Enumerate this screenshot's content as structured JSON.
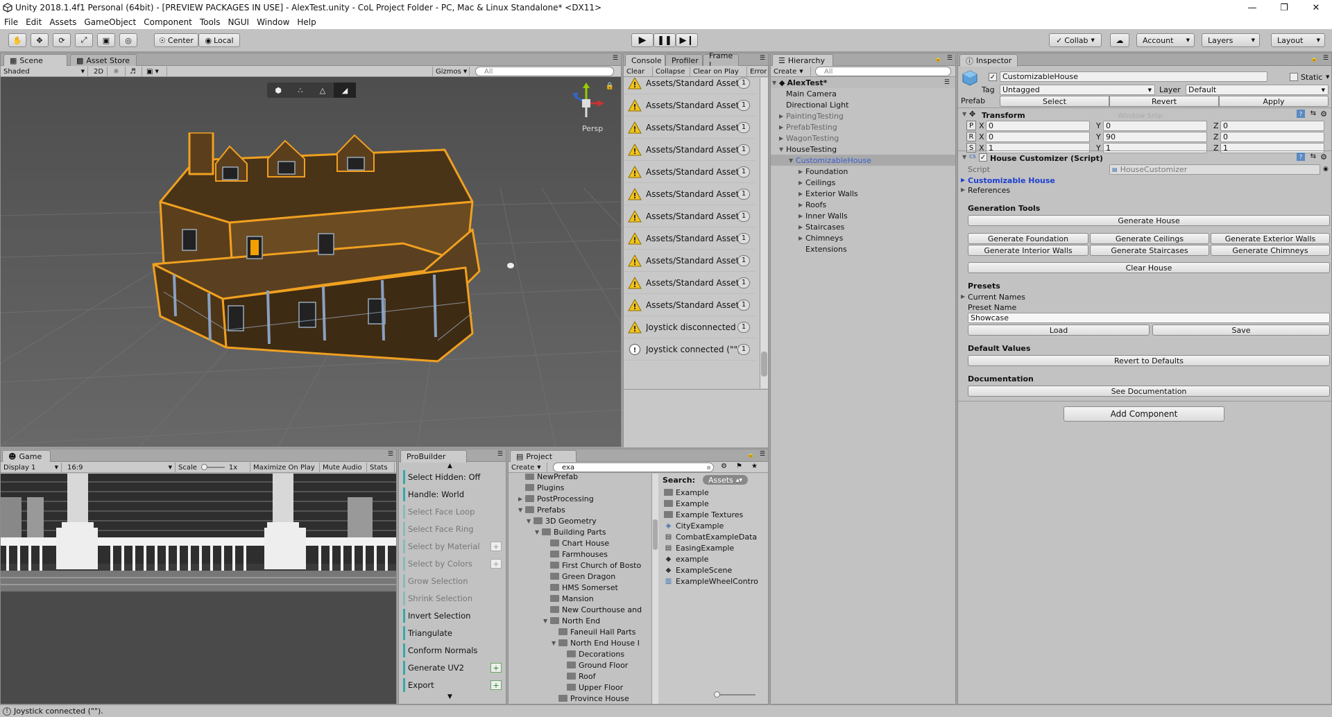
{
  "window": {
    "title": "Unity 2018.1.4f1 Personal (64bit) - [PREVIEW PACKAGES IN USE] - AlexTest.unity - CoL Project Folder - PC, Mac & Linux Standalone* <DX11>"
  },
  "menu": [
    "File",
    "Edit",
    "Assets",
    "GameObject",
    "Component",
    "Tools",
    "NGUI",
    "Window",
    "Help"
  ],
  "toolbar": {
    "center": "Center",
    "local": "Local",
    "collab": "Collab",
    "account": "Account",
    "layers": "Layers",
    "layout": "Layout"
  },
  "scene": {
    "tabs": [
      "Scene",
      "Asset Store"
    ],
    "shading": "Shaded",
    "mode2d": "2D",
    "gizmos": "Gizmos",
    "search_placeholder": "All",
    "persp": "Persp"
  },
  "console": {
    "tabs": [
      "Console",
      "Profiler",
      "Frame I"
    ],
    "buttons": [
      "Clear",
      "Collapse",
      "Clear on Play",
      "Error"
    ],
    "rows": [
      {
        "text": "Assets/Standard Assets",
        "count": "1",
        "type": "warn"
      },
      {
        "text": "Assets/Standard Assets",
        "count": "1",
        "type": "warn"
      },
      {
        "text": "Assets/Standard Assets",
        "count": "1",
        "type": "warn"
      },
      {
        "text": "Assets/Standard Assets",
        "count": "1",
        "type": "warn"
      },
      {
        "text": "Assets/Standard Assets",
        "count": "1",
        "type": "warn"
      },
      {
        "text": "Assets/Standard Assets",
        "count": "1",
        "type": "warn"
      },
      {
        "text": "Assets/Standard Assets",
        "count": "1",
        "type": "warn"
      },
      {
        "text": "Assets/Standard Assets",
        "count": "1",
        "type": "warn"
      },
      {
        "text": "Assets/Standard Assets",
        "count": "1",
        "type": "warn"
      },
      {
        "text": "Assets/Standard Assets",
        "count": "1",
        "type": "warn"
      },
      {
        "text": "Assets/Standard Assets",
        "count": "1",
        "type": "warn"
      },
      {
        "text": "Joystick disconnected (\"\").",
        "count": "1",
        "type": "warn"
      },
      {
        "text": "Joystick connected (\"\").",
        "count": "1",
        "type": "info"
      }
    ]
  },
  "hierarchy": {
    "tab": "Hierarchy",
    "create": "Create",
    "search_placeholder": "All",
    "scene": "AlexTest*",
    "items": [
      {
        "label": "Main Camera",
        "depth": 1,
        "arrow": ""
      },
      {
        "label": "Directional Light",
        "depth": 1,
        "arrow": ""
      },
      {
        "label": "PaintingTesting",
        "depth": 1,
        "arrow": "right",
        "dim": true
      },
      {
        "label": "PrefabTesting",
        "depth": 1,
        "arrow": "right",
        "dim": true
      },
      {
        "label": "WagonTesting",
        "depth": 1,
        "arrow": "right",
        "dim": true
      },
      {
        "label": "HouseTesting",
        "depth": 1,
        "arrow": "down"
      },
      {
        "label": "CustomizableHouse",
        "depth": 2,
        "arrow": "down",
        "selected": true
      },
      {
        "label": "Foundation",
        "depth": 3,
        "arrow": "right"
      },
      {
        "label": "Ceilings",
        "depth": 3,
        "arrow": "right"
      },
      {
        "label": "Exterior Walls",
        "depth": 3,
        "arrow": "right"
      },
      {
        "label": "Roofs",
        "depth": 3,
        "arrow": "right"
      },
      {
        "label": "Inner Walls",
        "depth": 3,
        "arrow": "right"
      },
      {
        "label": "Staircases",
        "depth": 3,
        "arrow": "right"
      },
      {
        "label": "Chimneys",
        "depth": 3,
        "arrow": "right"
      },
      {
        "label": "Extensions",
        "depth": 3,
        "arrow": ""
      }
    ]
  },
  "inspector": {
    "tab": "Inspector",
    "object_name": "CustomizableHouse",
    "static": "Static",
    "tag_label": "Tag",
    "tag": "Untagged",
    "layer_label": "Layer",
    "layer": "Default",
    "prefab_label": "Prefab",
    "prefab_select": "Select",
    "prefab_revert": "Revert",
    "prefab_apply": "Apply",
    "transform": {
      "title": "Transform",
      "rows": [
        {
          "k": "P",
          "x": "0",
          "y": "0",
          "z": "0"
        },
        {
          "k": "R",
          "x": "0",
          "y": "90",
          "z": "0"
        },
        {
          "k": "S",
          "x": "1",
          "y": "1",
          "z": "1"
        }
      ],
      "ghost": "Window Snip"
    },
    "script_component": "House Customizer (Script)",
    "script_label": "Script",
    "script_value": "HouseCustomizer",
    "customizable_house": "Customizable House",
    "references": "References",
    "generation_tools": "Generation Tools",
    "generate_house": "Generate House",
    "gen_buttons": [
      "Generate Foundation",
      "Generate Ceilings",
      "Generate Exterior Walls",
      "Generate Interior Walls",
      "Generate Staircases",
      "Generate Chimneys"
    ],
    "clear_house": "Clear House",
    "presets": "Presets",
    "current_names": "Current Names",
    "preset_name": "Preset Name",
    "preset_value": "Showcase",
    "load": "Load",
    "save": "Save",
    "default_values": "Default Values",
    "revert_defaults": "Revert to Defaults",
    "documentation": "Documentation",
    "see_documentation": "See Documentation",
    "add_component": "Add Component"
  },
  "game": {
    "tab": "Game",
    "display": "Display 1",
    "aspect": "16:9",
    "scale_label": "Scale",
    "scale_value": "1x",
    "maximize": "Maximize On Play",
    "mute": "Mute Audio",
    "stats": "Stats"
  },
  "probuilder": {
    "tab": "ProBuilder",
    "items": [
      {
        "label": "Select Hidden: Off",
        "dim": false,
        "plus": false
      },
      {
        "label": "Handle: World",
        "dim": false,
        "plus": false
      },
      {
        "label": "Select Face Loop",
        "dim": true,
        "plus": false
      },
      {
        "label": "Select Face Ring",
        "dim": true,
        "plus": false
      },
      {
        "label": "Select by Material",
        "dim": true,
        "plus": true
      },
      {
        "label": "Select by Colors",
        "dim": true,
        "plus": true
      },
      {
        "label": "Grow Selection",
        "dim": true,
        "plus": false
      },
      {
        "label": "Shrink Selection",
        "dim": true,
        "plus": false
      },
      {
        "label": "Invert Selection",
        "dim": false,
        "plus": false
      },
      {
        "label": "Triangulate",
        "dim": false,
        "plus": false
      },
      {
        "label": "Conform Normals",
        "dim": false,
        "plus": false
      },
      {
        "label": "Generate UV2",
        "dim": false,
        "plus": true
      },
      {
        "label": "Export",
        "dim": false,
        "plus": true
      }
    ]
  },
  "project": {
    "tab": "Project",
    "create": "Create",
    "search_value": "exa",
    "search_label": "Search:",
    "assets_chip": "Assets",
    "tree": [
      {
        "label": "NewPrefab",
        "depth": 1,
        "arrow": ""
      },
      {
        "label": "Plugins",
        "depth": 1,
        "arrow": ""
      },
      {
        "label": "PostProcessing",
        "depth": 1,
        "arrow": "right"
      },
      {
        "label": "Prefabs",
        "depth": 1,
        "arrow": "down"
      },
      {
        "label": "3D Geometry",
        "depth": 2,
        "arrow": "down"
      },
      {
        "label": "Building Parts",
        "depth": 3,
        "arrow": "down"
      },
      {
        "label": "Chart House",
        "depth": 4,
        "arrow": ""
      },
      {
        "label": "Farmhouses",
        "depth": 4,
        "arrow": ""
      },
      {
        "label": "First Church of Bosto",
        "depth": 4,
        "arrow": ""
      },
      {
        "label": "Green Dragon",
        "depth": 4,
        "arrow": ""
      },
      {
        "label": "HMS Somerset",
        "depth": 4,
        "arrow": ""
      },
      {
        "label": "Mansion",
        "depth": 4,
        "arrow": ""
      },
      {
        "label": "New Courthouse and",
        "depth": 4,
        "arrow": ""
      },
      {
        "label": "North End",
        "depth": 4,
        "arrow": "down"
      },
      {
        "label": "Faneuil Hall Parts",
        "depth": 5,
        "arrow": ""
      },
      {
        "label": "North End House I",
        "depth": 5,
        "arrow": "down"
      },
      {
        "label": "Decorations",
        "depth": 6,
        "arrow": ""
      },
      {
        "label": "Ground Floor",
        "depth": 6,
        "arrow": ""
      },
      {
        "label": "Roof",
        "depth": 6,
        "arrow": ""
      },
      {
        "label": "Upper Floor",
        "depth": 6,
        "arrow": ""
      },
      {
        "label": "Province House",
        "depth": 5,
        "arrow": ""
      }
    ],
    "results": [
      {
        "label": "Example",
        "kind": "folder"
      },
      {
        "label": "Example",
        "kind": "folder"
      },
      {
        "label": "Example Textures",
        "kind": "folder"
      },
      {
        "label": "CityExample",
        "kind": "prefab"
      },
      {
        "label": "CombatExampleData",
        "kind": "file"
      },
      {
        "label": "EasingExample",
        "kind": "file"
      },
      {
        "label": "example",
        "kind": "unity"
      },
      {
        "label": "ExampleScene",
        "kind": "unity"
      },
      {
        "label": "ExampleWheelContro",
        "kind": "script"
      }
    ]
  },
  "statusbar": {
    "text": "Joystick connected (\"\")."
  }
}
